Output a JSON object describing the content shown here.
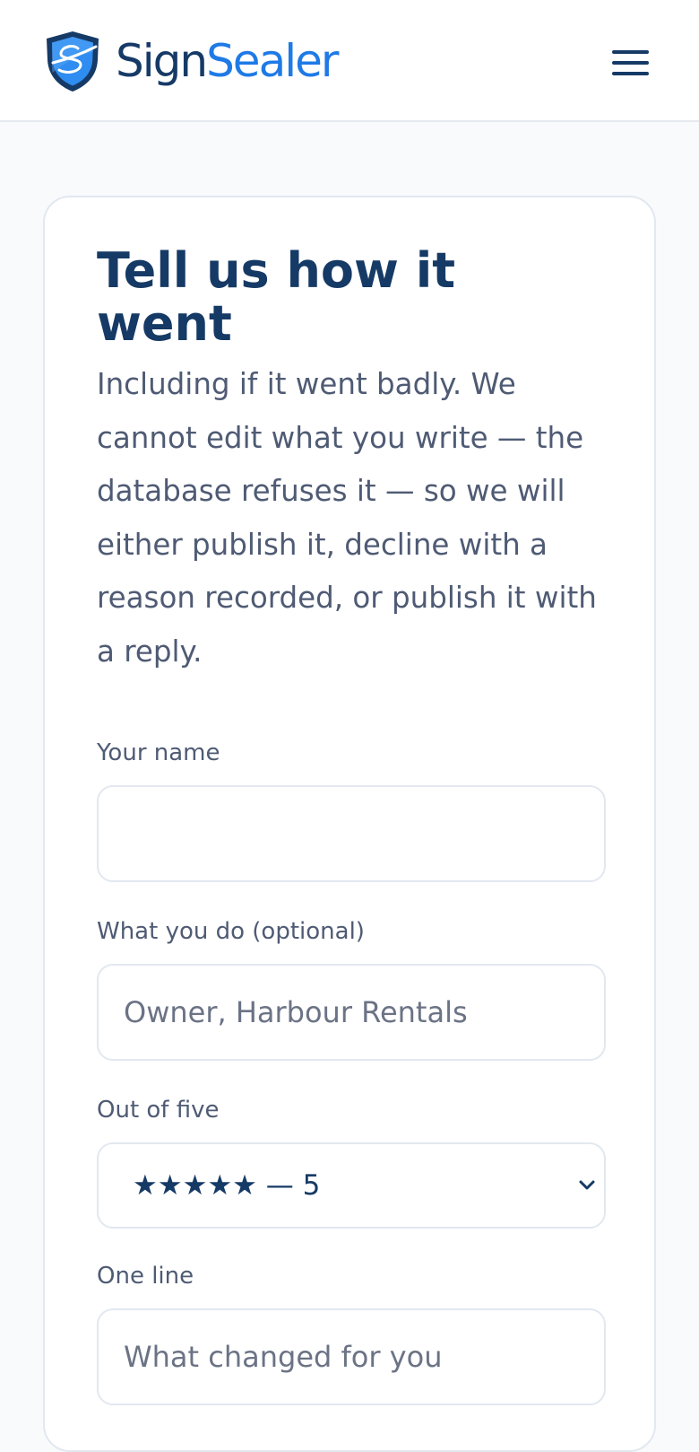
{
  "header": {
    "brand_part1": "Sign",
    "brand_part2": "Sealer",
    "logo_icon": "shield-signature-icon",
    "menu_icon": "hamburger-menu-icon"
  },
  "form": {
    "title": "Tell us how it went",
    "intro": "Including if it went badly. We cannot edit what you write — the database refuses it — so we will either publish it, decline with a reason recorded, or publish it with a reply.",
    "fields": {
      "name": {
        "label": "Your name",
        "value": "",
        "placeholder": ""
      },
      "role": {
        "label": "What you do (optional)",
        "value": "",
        "placeholder": "Owner, Harbour Rentals"
      },
      "rating": {
        "label": "Out of five",
        "selected": "★★★★★ — 5",
        "value": 5
      },
      "headline": {
        "label": "One line",
        "value": "",
        "placeholder": "What changed for you"
      }
    }
  },
  "colors": {
    "brand_dark": "#163a66",
    "brand_accent": "#1f7ae6",
    "body_text": "#4f5b74",
    "border": "#e2e8f0",
    "page_background": "#f8fafc"
  }
}
